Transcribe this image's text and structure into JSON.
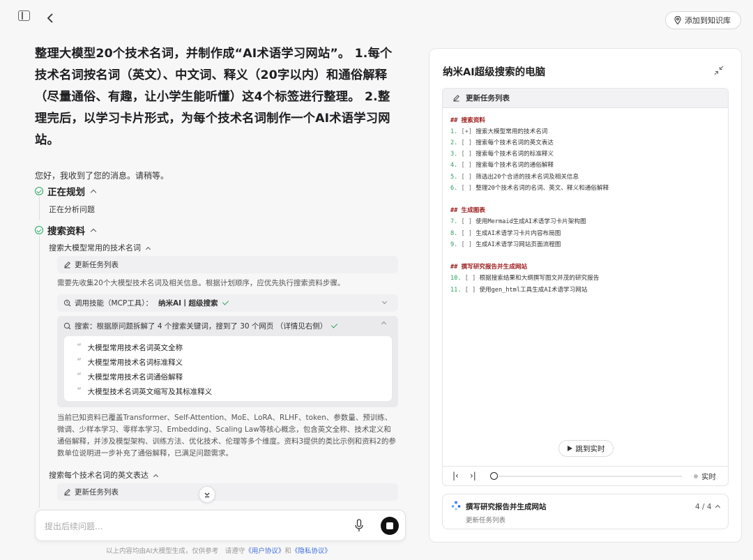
{
  "header": {
    "back_icon": "chevron-left-icon",
    "sidebar_icon": "sidebar-toggle-icon",
    "kb_button": "添加到知识库"
  },
  "conversation": {
    "prompt": "整理大模型20个技术名词，并制作成“AI术语学习网站”。 1.每个技术名词按名词（英文）、中文词、释义（20字以内）和通俗解释（尽量通俗、有趣，让小学生能听懂）这4个标签进行整理。 2.整理完后，以学习卡片形式，为每个技术名词制作一个AI术语学习网站。",
    "reply": "您好，我收到了您的消息。请稍等。",
    "steps": [
      {
        "title": "正在规划",
        "detail": "正在分析问题"
      },
      {
        "title": "搜索资料"
      }
    ],
    "substep1": {
      "title": "搜索大模型常用的技术名词",
      "update_card": "更新任务列表",
      "desc": "需要先收集20个大模型技术名词及相关信息。根据计划顺序，应优先执行搜索资料步骤。",
      "tool_card": {
        "label": "调用技能（MCP工具）：",
        "tool": "纳米AI丨超级搜索"
      },
      "search_card": {
        "label": "搜索：根据原问题拆解了 4 个搜索关键词，搜到了 30 个网页 （详情见右侧）",
        "queries": [
          "大模型常用技术名词英文全称",
          "大模型常用技术名词标准释义",
          "大模型常用技术名词通俗解释",
          "大模型技术名词英文缩写及其标准释义"
        ]
      },
      "summary": "当前已知资料已覆盖Transformer、Self-Attention、MoE、LoRA、RLHF、token、参数量、预训练、微调、少样本学习、零样本学习、Embedding、Scaling Law等核心概念，包含英文全称、技术定义和通俗解释，并涉及模型架构、训练方法、优化技术、伦理等多个维度。资料3提供的类比示例和资料2的参数单位说明进一步补充了通俗解释，已满足问题需求。"
    },
    "substep2": {
      "title": "搜索每个技术名词的英文表达",
      "update_card": "更新任务列表"
    }
  },
  "input": {
    "placeholder": "提出后续问题...",
    "disclaimer_prefix": "以上内容均由AI大模型生成，仅供参考　请遵守",
    "user_agreement": "《用户协议》",
    "and": "和",
    "privacy": "《隐私协议》"
  },
  "panel": {
    "title": "纳米AI超级搜索的电脑",
    "collapse_icon": "collapse-icon",
    "terminal_title": "更新任务列表",
    "sections": [
      {
        "heading": "## 搜索资料",
        "items": [
          {
            "n": "1.",
            "box": "[+]",
            "text": "搜索大模型常用的技术名词"
          },
          {
            "n": "2.",
            "box": "[ ]",
            "text": "搜索每个技术名词的英文表达"
          },
          {
            "n": "3.",
            "box": "[ ]",
            "text": "搜索每个技术名词的标准释义"
          },
          {
            "n": "4.",
            "box": "[ ]",
            "text": "搜索每个技术名词的通俗解释"
          },
          {
            "n": "5.",
            "box": "[ ]",
            "text": "筛选出20个合适的技术名词及相关信息"
          },
          {
            "n": "6.",
            "box": "[ ]",
            "text": "整理20个技术名词的名词、英文、释义和通俗解释"
          }
        ]
      },
      {
        "heading": "## 生成图表",
        "items": [
          {
            "n": "7.",
            "box": "[ ]",
            "text": "使用Mermaid生成AI术语学习卡片架构图"
          },
          {
            "n": "8.",
            "box": "[ ]",
            "text": "生成AI术语学习卡片内容布局图"
          },
          {
            "n": "9.",
            "box": "[ ]",
            "text": "生成AI术语学习网站页面流程图"
          }
        ]
      },
      {
        "heading": "## 撰写研究报告并生成网站",
        "items": [
          {
            "n": "10.",
            "box": "[ ]",
            "text": "根据搜索结果和大纲撰写图文并茂的研究报告"
          },
          {
            "n": "11.",
            "box": "[ ]",
            "text": "使用gen_html工具生成AI术语学习网站"
          }
        ]
      }
    ],
    "jump_label": "跳到实时",
    "live_label": "实时",
    "progress": 0,
    "task": {
      "title": "撰写研究报告并生成网站",
      "subtitle": "更新任务列表",
      "count": "4 / 4"
    }
  }
}
